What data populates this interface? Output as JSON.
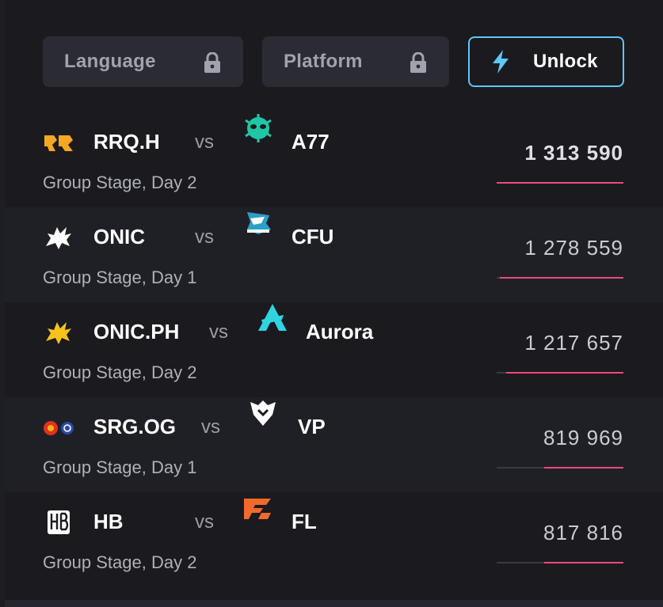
{
  "filters": {
    "language_label": "Language",
    "platform_label": "Platform",
    "unlock_label": "Unlock",
    "accent_color": "#5ec8f5"
  },
  "matches": [
    {
      "team_a": "RRQ.H",
      "team_a_logo": "rrq-logo-icon",
      "vs": "vs",
      "team_b": "A77",
      "team_b_logo": "a77-logo-icon",
      "stage": "Group Stage, Day 2",
      "viewers": "1 313 590",
      "viewers_share": 1.0
    },
    {
      "team_a": "ONIC",
      "team_a_logo": "onic-logo-icon",
      "vs": "vs",
      "team_b": "CFU",
      "team_b_logo": "cfu-logo-icon",
      "stage": "Group Stage, Day 1",
      "viewers": "1 278 559",
      "viewers_share": 0.973
    },
    {
      "team_a": "ONIC.PH",
      "team_a_logo": "onic-ph-logo-icon",
      "vs": "vs",
      "team_b": "Aurora",
      "team_b_logo": "aurora-logo-icon",
      "stage": "Group Stage, Day 2",
      "viewers": "1 217 657",
      "viewers_share": 0.927
    },
    {
      "team_a": "SRG.OG",
      "team_a_logo": "srg-og-logo-icon",
      "vs": "vs",
      "team_b": "VP",
      "team_b_logo": "vp-logo-icon",
      "stage": "Group Stage, Day 1",
      "viewers": "819 969",
      "viewers_share": 0.624
    },
    {
      "team_a": "HB",
      "team_a_logo": "hb-logo-icon",
      "vs": "vs",
      "team_b": "FL",
      "team_b_logo": "fl-logo-icon",
      "stage": "Group Stage, Day 2",
      "viewers": "817 816",
      "viewers_share": 0.623
    }
  ],
  "colors": {
    "bar_fill": "#f0487a",
    "bar_track": "#3a3b42"
  }
}
